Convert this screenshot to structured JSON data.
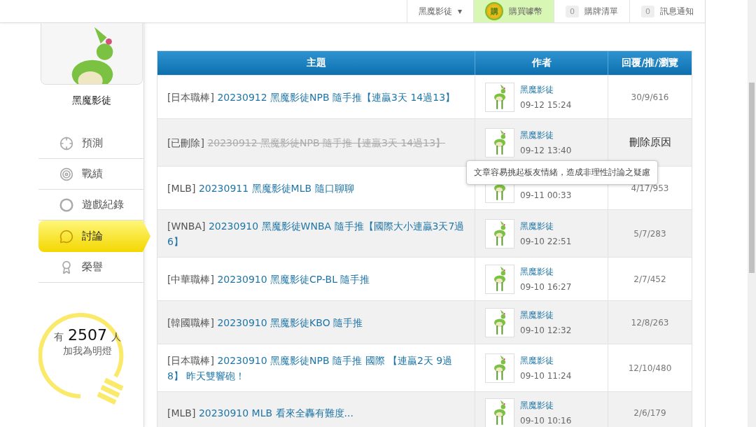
{
  "top_bar": {
    "user": {
      "label": "黑魔影徒",
      "caret": "▾"
    },
    "buy_coins": {
      "badge": "購",
      "label": "購買噱幣"
    },
    "counters": [
      {
        "count": "0",
        "label": "購牌清單"
      },
      {
        "count": "0",
        "label": "訊息通知"
      }
    ]
  },
  "sidebar": {
    "profile": {
      "name": "黑魔影徒"
    },
    "menu": [
      {
        "kind": "crosshair",
        "label": "預測",
        "selected": false
      },
      {
        "kind": "target",
        "label": "戰績",
        "selected": false
      },
      {
        "kind": "ring",
        "label": "遊戲紀錄",
        "selected": false
      },
      {
        "kind": "chat",
        "label": "討論",
        "selected": true
      },
      {
        "kind": "medal",
        "label": "榮譽",
        "selected": false
      }
    ],
    "fans": {
      "prefix": "有",
      "count": "2507",
      "suffix": "人",
      "caption": "加我為明燈"
    }
  },
  "table": {
    "columns": [
      "主題",
      "作者",
      "回覆/推/瀏覽"
    ],
    "rows": [
      {
        "category": "[日本職棒]",
        "title": "20230912 黑魔影徒NPB 隨手推【連贏3天 14過13】",
        "deleted": false,
        "author": "黑魔影徒",
        "time": "09-12 15:24",
        "stats": "30/9/616"
      },
      {
        "category": "[已刪除]",
        "title": "20230912 黑魔影徒NPB 隨手推【連贏3天 14過13】",
        "deleted": true,
        "author": "黑魔影徒",
        "time": "09-12 13:40",
        "stats": "刪除原因"
      },
      {
        "category": "[MLB]",
        "title": "20230911 黑魔影徒MLB 隨口聊聊",
        "deleted": false,
        "time": "09-11 00:33",
        "stats": "4/17/953"
      },
      {
        "category": "[WNBA]",
        "title": "20230910 黑魔影徒WNBA 隨手推【國際大小連贏3天7過6】",
        "deleted": false,
        "author": "黑魔影徒",
        "time": "09-10 22:51",
        "stats": "5/7/283"
      },
      {
        "category": "[中華職棒]",
        "title": "20230910 黑魔影徒CP-BL 隨手推",
        "deleted": false,
        "author": "黑魔影徒",
        "time": "09-10 16:27",
        "stats": "2/7/452"
      },
      {
        "category": "[韓國職棒]",
        "title": "20230910 黑魔影徒KBO 隨手推",
        "deleted": false,
        "author": "黑魔影徒",
        "time": "09-10 12:32",
        "stats": "12/8/263"
      },
      {
        "category": "[日本職棒]",
        "title": "20230910 黑魔影徒NPB 隨手推 國際 【連贏2天 9過8】 昨天雙響砲！",
        "deleted": false,
        "author": "黑魔影徒",
        "time": "09-10 11:24",
        "stats": "12/10/480"
      },
      {
        "category": "[MLB]",
        "title": "20230910 MLB 看來全轟有難度...",
        "deleted": false,
        "author": "黑魔影徒",
        "time": "09-10 10:16",
        "stats": "2/6/179"
      }
    ],
    "tooltip": "文章容易挑起板友情緒，造成非理性討論之疑慮"
  }
}
